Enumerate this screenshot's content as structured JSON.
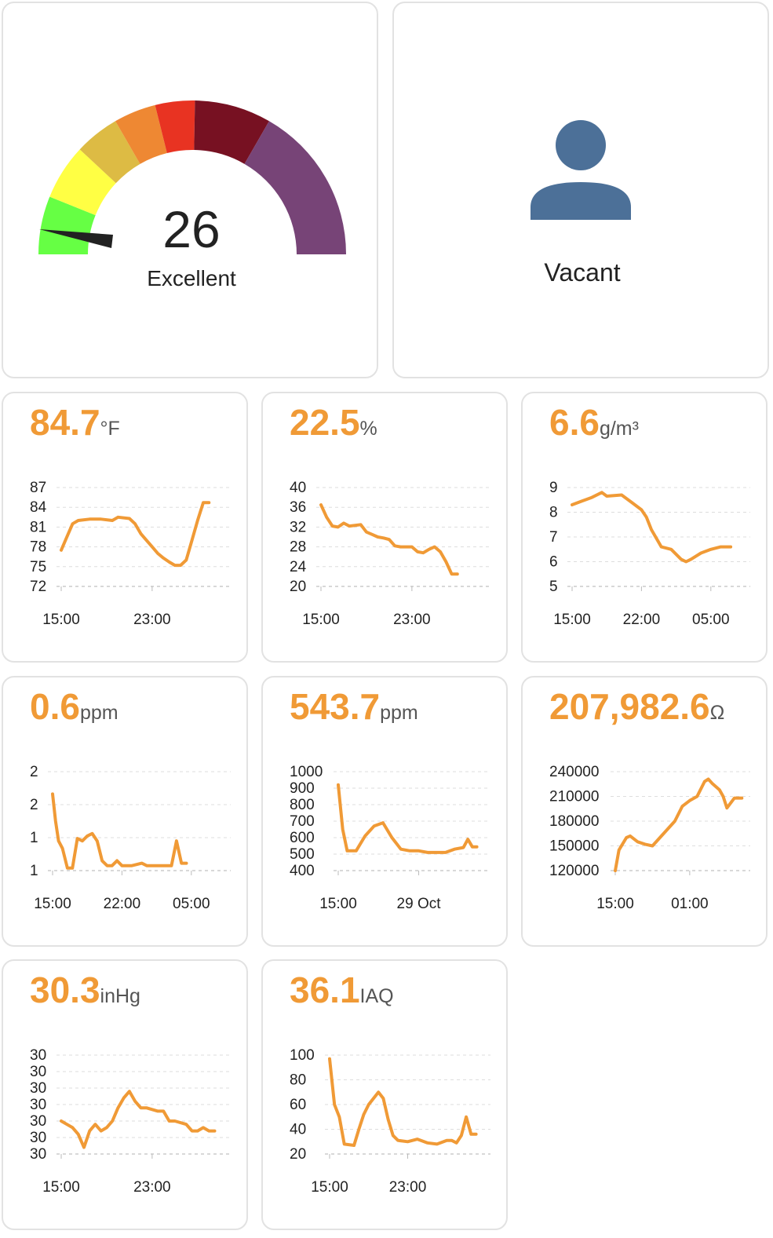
{
  "gauge": {
    "value": "26",
    "rating": "Excellent",
    "segment_colors": [
      "#66ff44",
      "#ffff44",
      "#ddbb44",
      "#ee8833",
      "#e83322",
      "#771122",
      "#774477"
    ],
    "needle_color": "#222222"
  },
  "occupancy": {
    "status": "Vacant",
    "icon": "person-icon",
    "icon_color": "#4c7098"
  },
  "accent_color": "#f09a36",
  "sensors": [
    {
      "id": "temperature",
      "value": "84.7",
      "unit": "°F",
      "chart_data": {
        "type": "line",
        "y_ticks": [
          "87",
          "84",
          "81",
          "78",
          "75",
          "72"
        ],
        "ylim": [
          72,
          87
        ],
        "x_ticks": [
          {
            "label": "15:00",
            "x": 0
          },
          {
            "label": "23:00",
            "x": 8
          }
        ],
        "xlim": [
          0,
          14.5
        ],
        "points": [
          [
            0,
            77.5
          ],
          [
            0.5,
            79.5
          ],
          [
            1,
            81.5
          ],
          [
            1.5,
            82.0
          ],
          [
            2.5,
            82.2
          ],
          [
            3.5,
            82.2
          ],
          [
            4.5,
            82.0
          ],
          [
            5,
            82.5
          ],
          [
            6,
            82.3
          ],
          [
            6.5,
            81.5
          ],
          [
            7,
            80.0
          ],
          [
            7.5,
            79.0
          ],
          [
            8,
            78.0
          ],
          [
            8.5,
            77.0
          ],
          [
            9,
            76.3
          ],
          [
            9.5,
            75.7
          ],
          [
            10,
            75.2
          ],
          [
            10.5,
            75.2
          ],
          [
            11,
            76.0
          ],
          [
            11.5,
            79.0
          ],
          [
            12,
            82.0
          ],
          [
            12.5,
            84.7
          ],
          [
            13,
            84.7
          ]
        ]
      }
    },
    {
      "id": "humidity",
      "value": "22.5",
      "unit": "%",
      "chart_data": {
        "type": "line",
        "y_ticks": [
          "40",
          "36",
          "32",
          "28",
          "24",
          "20"
        ],
        "ylim": [
          20,
          40
        ],
        "x_ticks": [
          {
            "label": "15:00",
            "x": 0
          },
          {
            "label": "23:00",
            "x": 8
          }
        ],
        "xlim": [
          0,
          14.5
        ],
        "points": [
          [
            0,
            36.5
          ],
          [
            0.5,
            34.0
          ],
          [
            1,
            32.2
          ],
          [
            1.5,
            32.0
          ],
          [
            2,
            32.8
          ],
          [
            2.5,
            32.2
          ],
          [
            3.5,
            32.5
          ],
          [
            4,
            31.0
          ],
          [
            4.5,
            30.5
          ],
          [
            5,
            30.0
          ],
          [
            5.5,
            29.8
          ],
          [
            6,
            29.5
          ],
          [
            6.5,
            28.2
          ],
          [
            7,
            28.0
          ],
          [
            8,
            28.0
          ],
          [
            8.5,
            27.0
          ],
          [
            9,
            26.8
          ],
          [
            9.5,
            27.5
          ],
          [
            10,
            28.0
          ],
          [
            10.5,
            27.0
          ],
          [
            11,
            25.0
          ],
          [
            11.5,
            22.5
          ],
          [
            12,
            22.5
          ]
        ]
      }
    },
    {
      "id": "absolute-humidity",
      "value": "6.6",
      "unit": "g/m³",
      "chart_data": {
        "type": "line",
        "y_ticks": [
          "9",
          "8",
          "7",
          "6",
          "5"
        ],
        "ylim": [
          5,
          9
        ],
        "x_ticks": [
          {
            "label": "15:00",
            "x": 0
          },
          {
            "label": "22:00",
            "x": 7
          },
          {
            "label": "05:00",
            "x": 14
          }
        ],
        "xlim": [
          0,
          17.5
        ],
        "points": [
          [
            0,
            8.3
          ],
          [
            1,
            8.45
          ],
          [
            2,
            8.6
          ],
          [
            3,
            8.8
          ],
          [
            3.5,
            8.65
          ],
          [
            5,
            8.7
          ],
          [
            6,
            8.4
          ],
          [
            7,
            8.1
          ],
          [
            7.5,
            7.8
          ],
          [
            8,
            7.3
          ],
          [
            9,
            6.6
          ],
          [
            10,
            6.5
          ],
          [
            11,
            6.1
          ],
          [
            11.5,
            6.0
          ],
          [
            12,
            6.1
          ],
          [
            13,
            6.35
          ],
          [
            14,
            6.5
          ],
          [
            15,
            6.6
          ],
          [
            16,
            6.6
          ]
        ]
      }
    },
    {
      "id": "carbon-monoxide",
      "value": "0.6",
      "unit": "ppm",
      "chart_data": {
        "type": "line",
        "y_ticks": [
          "2",
          "2",
          "1",
          "1"
        ],
        "ylim": [
          0.5,
          2.5
        ],
        "x_ticks": [
          {
            "label": "15:00",
            "x": 0
          },
          {
            "label": "22:00",
            "x": 7
          },
          {
            "label": "05:00",
            "x": 14
          }
        ],
        "xlim": [
          0,
          17.5
        ],
        "points": [
          [
            0,
            2.05
          ],
          [
            0.3,
            1.5
          ],
          [
            0.6,
            1.1
          ],
          [
            1,
            0.95
          ],
          [
            1.5,
            0.55
          ],
          [
            2,
            0.55
          ],
          [
            2.5,
            1.15
          ],
          [
            3,
            1.1
          ],
          [
            3.5,
            1.2
          ],
          [
            4,
            1.25
          ],
          [
            4.5,
            1.1
          ],
          [
            5,
            0.7
          ],
          [
            5.5,
            0.6
          ],
          [
            6,
            0.6
          ],
          [
            6.5,
            0.7
          ],
          [
            7,
            0.6
          ],
          [
            8,
            0.6
          ],
          [
            9,
            0.65
          ],
          [
            9.5,
            0.6
          ],
          [
            10,
            0.6
          ],
          [
            11,
            0.6
          ],
          [
            12,
            0.6
          ],
          [
            12.5,
            1.1
          ],
          [
            13,
            0.65
          ],
          [
            13.5,
            0.65
          ]
        ]
      }
    },
    {
      "id": "co2",
      "value": "543.7",
      "unit": "ppm",
      "chart_data": {
        "type": "line",
        "y_ticks": [
          "1000",
          "900",
          "800",
          "700",
          "600",
          "500",
          "400"
        ],
        "ylim": [
          400,
          1000
        ],
        "x_ticks": [
          {
            "label": "15:00",
            "x": 0
          },
          {
            "label": "29 Oct",
            "x": 9
          }
        ],
        "xlim": [
          0,
          16.5
        ],
        "points": [
          [
            0,
            920
          ],
          [
            0.5,
            650
          ],
          [
            1,
            520
          ],
          [
            2,
            520
          ],
          [
            3,
            610
          ],
          [
            4,
            670
          ],
          [
            5,
            690
          ],
          [
            6,
            600
          ],
          [
            7,
            530
          ],
          [
            8,
            520
          ],
          [
            9,
            520
          ],
          [
            10,
            510
          ],
          [
            11,
            510
          ],
          [
            12,
            510
          ],
          [
            13,
            530
          ],
          [
            14,
            540
          ],
          [
            14.5,
            590
          ],
          [
            15,
            544
          ],
          [
            15.5,
            544
          ]
        ]
      }
    },
    {
      "id": "gas-resistance",
      "value": "207,982.6",
      "unit": "Ω",
      "chart_data": {
        "type": "line",
        "y_ticks": [
          "240000",
          "210000",
          "180000",
          "150000",
          "120000"
        ],
        "ylim": [
          120000,
          240000
        ],
        "x_ticks": [
          {
            "label": "15:00",
            "x": 0
          },
          {
            "label": "01:00",
            "x": 10
          }
        ],
        "xlim": [
          0,
          17.5
        ],
        "points": [
          [
            0,
            120000
          ],
          [
            0.5,
            145000
          ],
          [
            1.5,
            160000
          ],
          [
            2,
            162000
          ],
          [
            3,
            155000
          ],
          [
            4,
            152000
          ],
          [
            5,
            150000
          ],
          [
            6,
            160000
          ],
          [
            7,
            170000
          ],
          [
            8,
            180000
          ],
          [
            9,
            198000
          ],
          [
            10,
            205000
          ],
          [
            11,
            210000
          ],
          [
            12,
            228000
          ],
          [
            12.5,
            231000
          ],
          [
            13,
            226000
          ],
          [
            14,
            218000
          ],
          [
            14.5,
            210000
          ],
          [
            15,
            196000
          ],
          [
            16,
            208000
          ],
          [
            17,
            208000
          ]
        ]
      }
    },
    {
      "id": "pressure",
      "value": "30.3",
      "unit": "inHg",
      "chart_data": {
        "type": "line",
        "y_ticks": [
          "30",
          "30",
          "30",
          "30",
          "30",
          "30",
          "30"
        ],
        "ylim": [
          30.2,
          30.35
        ],
        "x_ticks": [
          {
            "label": "15:00",
            "x": 0
          },
          {
            "label": "23:00",
            "x": 8
          }
        ],
        "xlim": [
          0,
          14.5
        ],
        "points": [
          [
            0,
            30.25
          ],
          [
            0.5,
            30.245
          ],
          [
            1,
            30.24
          ],
          [
            1.5,
            30.23
          ],
          [
            2,
            30.21
          ],
          [
            2.5,
            30.235
          ],
          [
            3,
            30.245
          ],
          [
            3.5,
            30.235
          ],
          [
            4,
            30.24
          ],
          [
            4.5,
            30.25
          ],
          [
            5,
            30.27
          ],
          [
            5.5,
            30.285
          ],
          [
            6,
            30.295
          ],
          [
            6.5,
            30.28
          ],
          [
            7,
            30.27
          ],
          [
            7.5,
            30.27
          ],
          [
            8.5,
            30.265
          ],
          [
            9,
            30.265
          ],
          [
            9.5,
            30.25
          ],
          [
            10,
            30.25
          ],
          [
            11,
            30.245
          ],
          [
            11.5,
            30.235
          ],
          [
            12,
            30.235
          ],
          [
            12.5,
            30.24
          ],
          [
            13,
            30.235
          ],
          [
            13.5,
            30.235
          ]
        ]
      }
    },
    {
      "id": "iaq",
      "value": "36.1",
      "unit": "IAQ",
      "chart_data": {
        "type": "line",
        "y_ticks": [
          "100",
          "80",
          "60",
          "40",
          "20"
        ],
        "ylim": [
          20,
          100
        ],
        "x_ticks": [
          {
            "label": "15:00",
            "x": 0
          },
          {
            "label": "23:00",
            "x": 8
          }
        ],
        "xlim": [
          0,
          16
        ],
        "points": [
          [
            0,
            97
          ],
          [
            0.5,
            60
          ],
          [
            1,
            50
          ],
          [
            1.5,
            28
          ],
          [
            2.5,
            27
          ],
          [
            3,
            40
          ],
          [
            3.5,
            52
          ],
          [
            4,
            60
          ],
          [
            4.5,
            65
          ],
          [
            5,
            70
          ],
          [
            5.5,
            65
          ],
          [
            6,
            48
          ],
          [
            6.5,
            35
          ],
          [
            7,
            31
          ],
          [
            8,
            30
          ],
          [
            9,
            32
          ],
          [
            10,
            29
          ],
          [
            11,
            28
          ],
          [
            12,
            31
          ],
          [
            12.5,
            31
          ],
          [
            13,
            29
          ],
          [
            13.5,
            35
          ],
          [
            14,
            50
          ],
          [
            14.5,
            36
          ],
          [
            15,
            36
          ]
        ]
      }
    }
  ]
}
